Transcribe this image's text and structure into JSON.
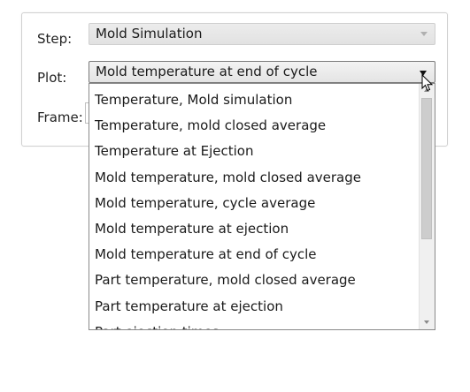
{
  "form": {
    "step_label": "Step:",
    "step_value": "Mold Simulation",
    "plot_label": "Plot:",
    "plot_value": "Mold temperature at end of cycle",
    "frame_label": "Frame:"
  },
  "dropdown": {
    "options": [
      "Temperature, Mold simulation",
      "Temperature, mold closed average",
      "Temperature at Ejection",
      "Mold temperature, mold closed average",
      "Mold temperature, cycle average",
      "Mold temperature at ejection",
      "Mold temperature at end of cycle",
      "Part temperature, mold closed average",
      "Part temperature at ejection",
      "Part ejection times"
    ]
  },
  "icons": {
    "step_arrow": "chevron-down-icon",
    "plot_arrow": "chevron-down-icon",
    "cursor": "mouse-pointer-icon",
    "scroll_up": "scroll-up-icon",
    "scroll_down": "scroll-down-icon"
  }
}
